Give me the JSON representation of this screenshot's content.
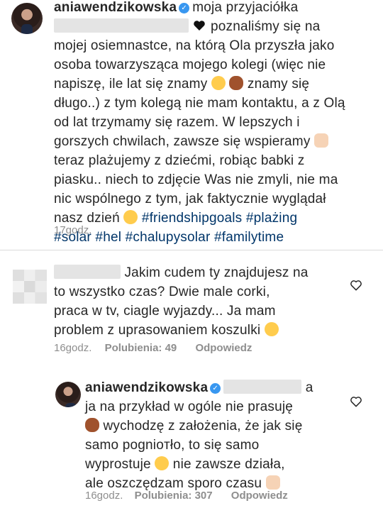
{
  "post": {
    "username": "aniawendzikowska",
    "verified_icon": "verified-badge-icon",
    "caption_lines": [
      "moja przyjaciółka",
      "poznaliśmy się na",
      "mojej osiemnastce, na którą Ola przyszła jako",
      "osoba towarzysząca mojego kolegi (więc nie",
      "napiszę, ile lat się znamy",
      "znamy się",
      "długo..) z tym kolegą nie mam kontaktu, a z Olą",
      "od lat trzymamy się razem. W lepszych i",
      "gorszych chwilach, zawsze się wspieramy",
      "teraz plażujemy z dziećmi, robiąc babki z",
      "piasku.. niech to zdjęcie Was nie zmyli, nie ma",
      "nic wspólnego z tym, jak faktycznie wyglądał",
      "nasz dzień"
    ],
    "hashtags_line1": "#friendshipgoals #plażing",
    "hashtags_line2": "#solar #hel #chalupysolar #familytime",
    "time": "17godz."
  },
  "comment1": {
    "lines": [
      "Jakim cudem ty znajdujesz na",
      "to wszystko czas? Dwie male corki,",
      "praca w tv, ciagle wyjazdy... Ja mam",
      "problem z uprasowaniem koszulki"
    ],
    "time": "16godz.",
    "likes": "Polubienia: 49",
    "reply": "Odpowiedz",
    "like_icon": "heart-outline-icon"
  },
  "reply1": {
    "username": "aniawendzikowska",
    "mention_tail": "a",
    "lines": [
      "ja na przykład w ogóle nie prasuję",
      "wychodzę z założenia, że jak się",
      "samo pognioтło, to się samo",
      "wyprostuje",
      "nie zawsze działa,",
      "ale oszczędzam sporo czasu"
    ],
    "time": "16godz.",
    "likes": "Polubienia: 307",
    "reply": "Odpowiedz",
    "like_icon": "heart-outline-icon"
  }
}
